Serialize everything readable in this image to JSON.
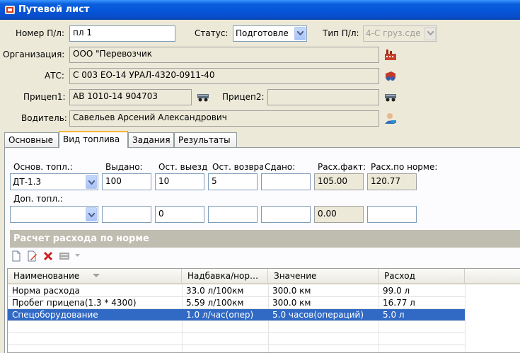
{
  "window": {
    "title": "Путевой лист"
  },
  "form": {
    "number_label": "Номер П/л:",
    "number_value": "пл 1",
    "status_label": "Статус:",
    "status_value": "Подготовле",
    "type_label": "Тип П/л:",
    "type_value": "4-С груз.сде",
    "org_label": "Организация:",
    "org_value": "ООО \"Перевозчик",
    "ats_label": "АТС:",
    "ats_value": "С 003 ЕО-14 УРАЛ-4320-0911-40",
    "trailer1_label": "Прицеп1:",
    "trailer1_value": "АВ 1010-14 904703",
    "trailer2_label": "Прицеп2:",
    "trailer2_value": "",
    "driver_label": "Водитель:",
    "driver_value": "Савельев Арсений Александрович"
  },
  "tabs": [
    {
      "label": "Основные"
    },
    {
      "label": "Вид топлива"
    },
    {
      "label": "Задания"
    },
    {
      "label": "Результаты"
    }
  ],
  "fuel": {
    "main_label": "Основ. топл.:",
    "issued_label": "Выдано:",
    "rem_out_label": "Ост. выезд",
    "rem_ret_label": "Ост. возвра",
    "returned_label": "Сдано:",
    "fact_label": "Расх.факт:",
    "norm_label": "Расх.по норме:",
    "main_value": "ДТ-1.3",
    "issued_value": "100",
    "rem_out_value": "10",
    "rem_ret_value": "5",
    "returned_value": "",
    "fact_value": "105.00",
    "norm_value": "120.77",
    "extra_label": "Доп. топл.:",
    "extra_value": "",
    "extra_issued": "",
    "extra_rem_out": "0",
    "extra_rem_ret": "",
    "extra_returned": "",
    "extra_fact": "0.00",
    "extra_norm": ""
  },
  "norm_section": {
    "title": "Расчет расхода по норме"
  },
  "grid": {
    "columns": [
      "Наименование",
      "Надбавка/нор…",
      "Значение",
      "Расход"
    ],
    "rows": [
      {
        "name": "Норма расхода",
        "addon": "33.0 л/100км",
        "value": "300.0 км",
        "consumption": "99.0 л"
      },
      {
        "name": "Пробег прицепа(1.3 * 4300)",
        "addon": "5.59 л/100км",
        "value": "300.0 км",
        "consumption": "16.77 л"
      },
      {
        "name": "Спецоборудование",
        "addon": "1.0 л/час(опер)",
        "value": "5.0 часов(операций)",
        "consumption": "5.0 л"
      }
    ]
  }
}
